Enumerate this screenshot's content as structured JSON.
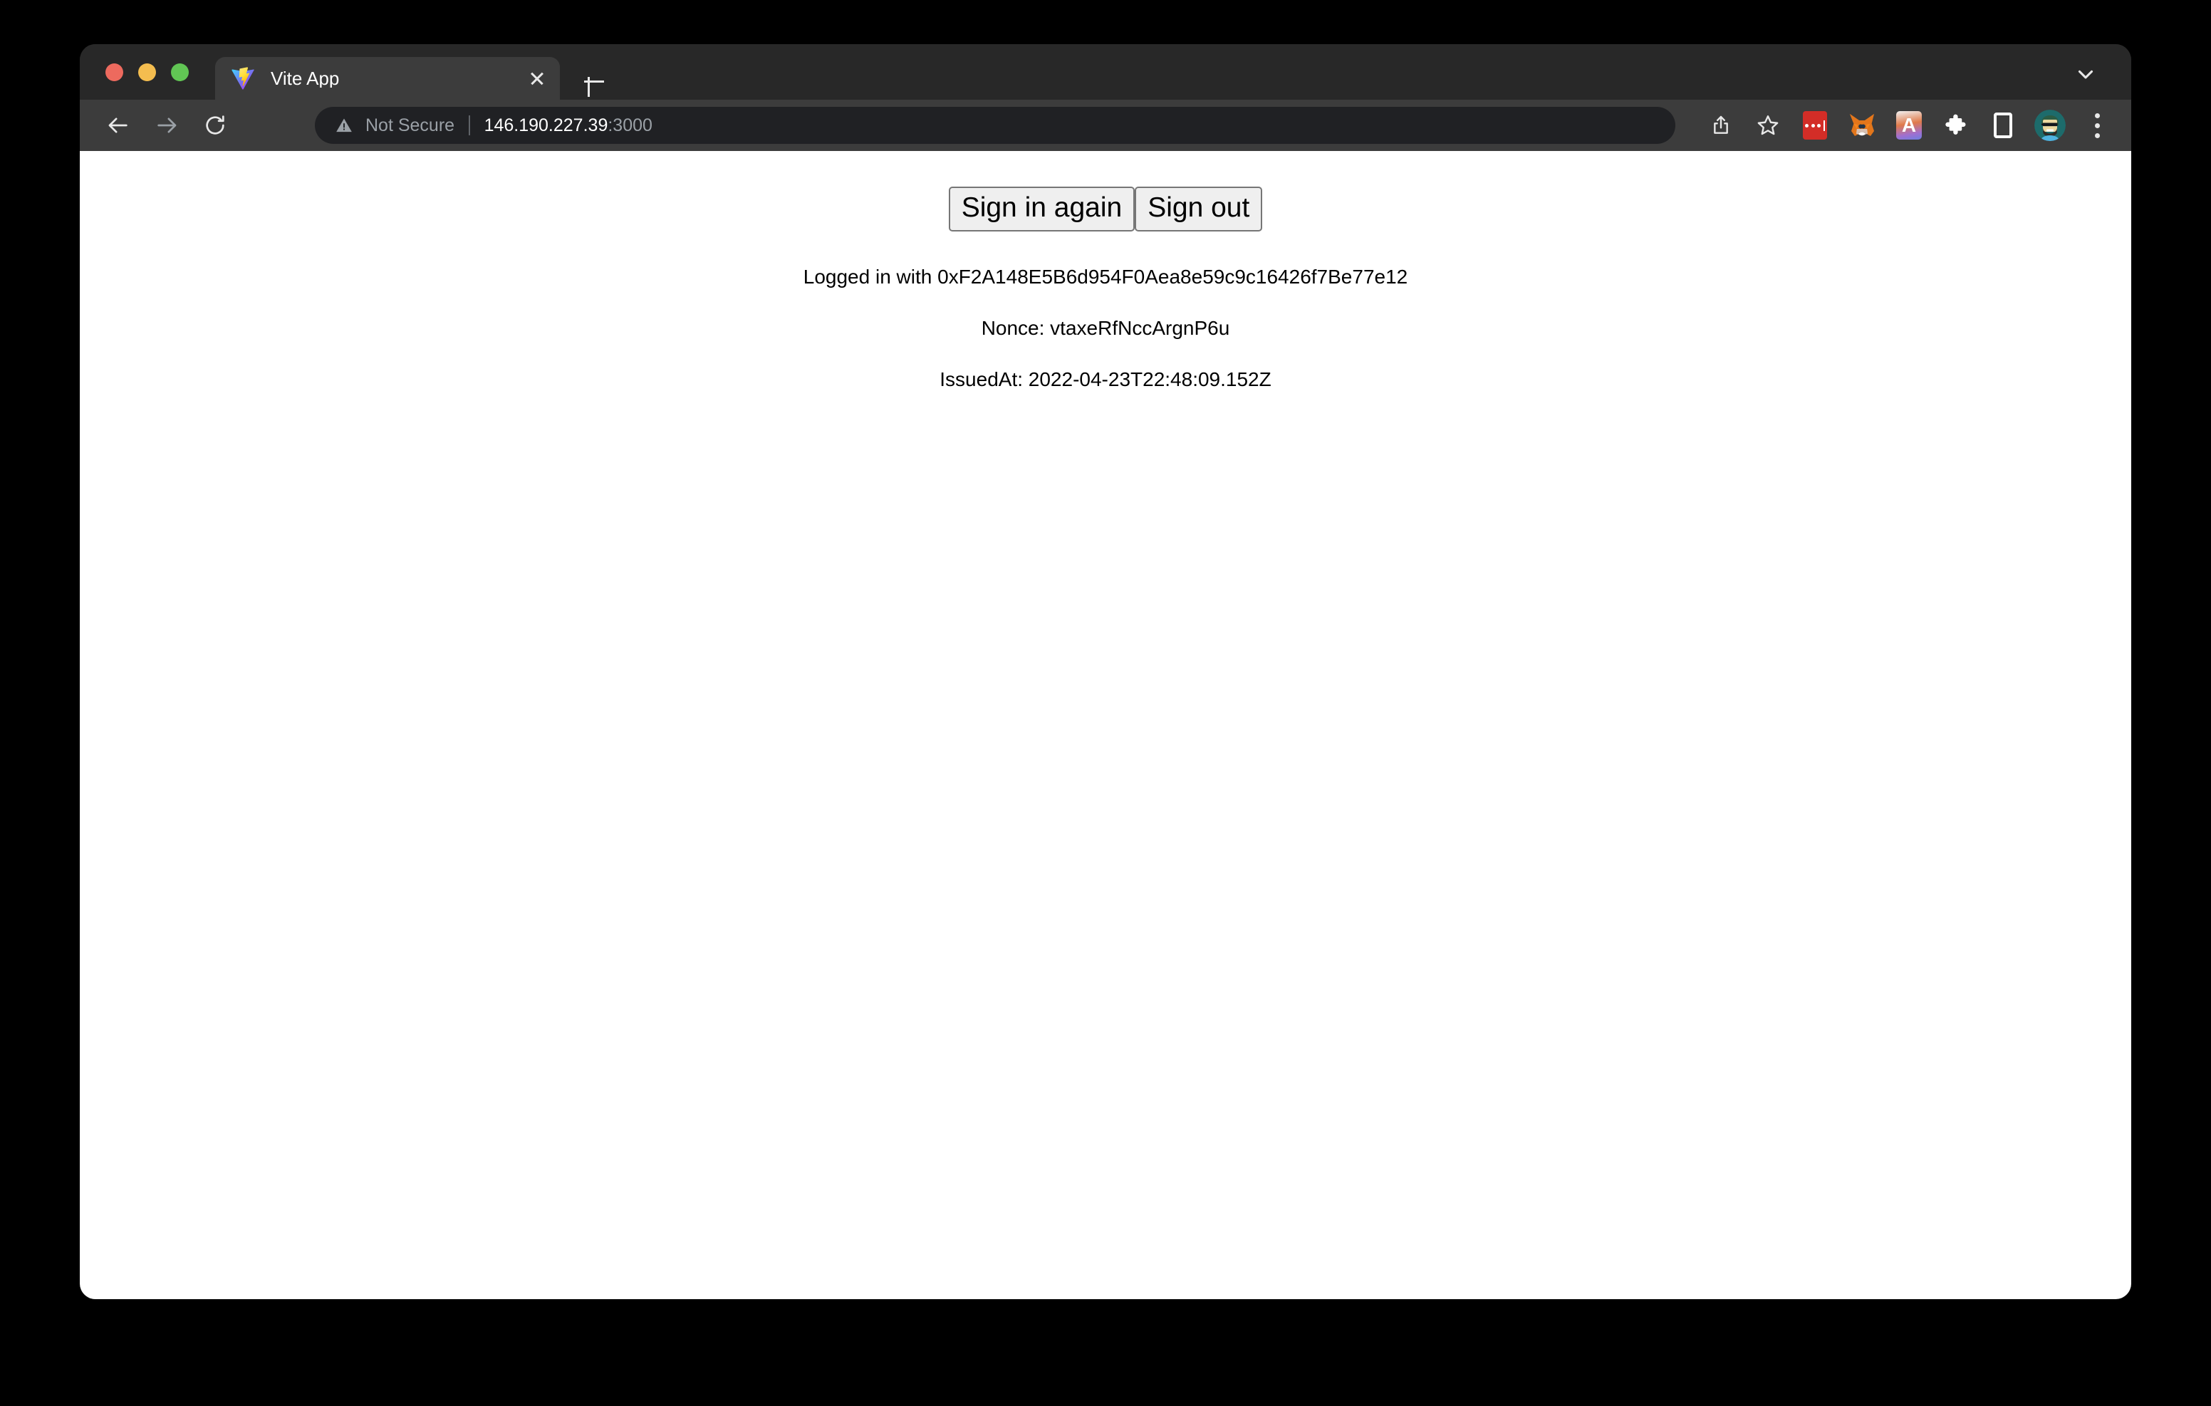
{
  "window": {
    "traffic_lights": [
      {
        "name": "close",
        "color": "#ed6a5e"
      },
      {
        "name": "minimize",
        "color": "#f4bd4f"
      },
      {
        "name": "maximize",
        "color": "#61c554"
      }
    ]
  },
  "tab_strip": {
    "tabs": [
      {
        "title": "Vite App",
        "favicon": "vite-logo-icon",
        "close_label": "Close tab"
      }
    ],
    "new_tab_label": "New Tab",
    "tab_search_label": "Search tabs"
  },
  "toolbar": {
    "back_label": "Back",
    "forward_label": "Forward",
    "reload_label": "Reload",
    "omnibox": {
      "security_icon": "warning-triangle-icon",
      "security_label": "Not Secure",
      "url_host": "146.190.227.39",
      "url_port": ":3000"
    },
    "actions": [
      {
        "name": "share-icon",
        "label": "Share"
      },
      {
        "name": "bookmark-star-icon",
        "label": "Bookmark this tab"
      },
      {
        "name": "lastpass-extension-icon",
        "label": "LastPass"
      },
      {
        "name": "metamask-extension-icon",
        "label": "MetaMask"
      },
      {
        "name": "a-extension-icon",
        "label": "A",
        "glyph": "A"
      },
      {
        "name": "extensions-puzzle-icon",
        "label": "Extensions"
      },
      {
        "name": "side-panel-icon",
        "label": "Side panel"
      },
      {
        "name": "profile-avatar",
        "label": "Profile"
      },
      {
        "name": "menu-dots-icon",
        "label": "Customize and control Chrome"
      }
    ]
  },
  "page": {
    "buttons": {
      "sign_in_again": "Sign in again",
      "sign_out": "Sign out"
    },
    "address_line": "Logged in with 0xF2A148E5B6d954F0Aea8e59c9c16426f7Be77e12",
    "nonce_line": "Nonce: vtaxeRfNccArgnP6u",
    "issued_at_line": "IssuedAt: 2022-04-23T22:48:09.152Z"
  },
  "colors": {
    "tab_strip_bg": "#282828",
    "toolbar_bg": "#3c3c3c",
    "active_tab_bg": "#3c3c3c",
    "omnibox_bg": "#202124",
    "page_bg": "#ffffff",
    "muted_text": "#9aa0a6"
  }
}
